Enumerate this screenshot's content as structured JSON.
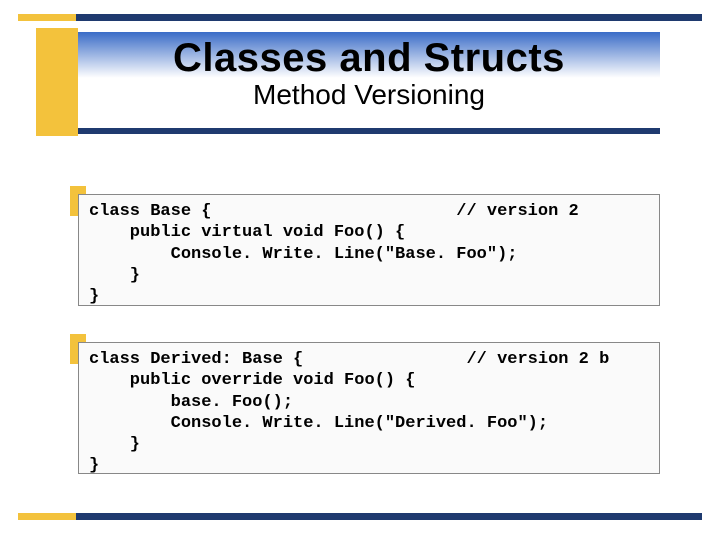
{
  "header": {
    "title": "Classes and Structs",
    "subtitle": "Method Versioning"
  },
  "code_blocks": {
    "block1": "class Base {                        // version 2\n    public virtual void Foo() {\n        Console. Write. Line(\"Base. Foo\");\n    }\n}",
    "block2": "class Derived: Base {                // version 2 b\n    public override void Foo() {\n        base. Foo();\n        Console. Write. Line(\"Derived. Foo\");\n    }\n}"
  }
}
